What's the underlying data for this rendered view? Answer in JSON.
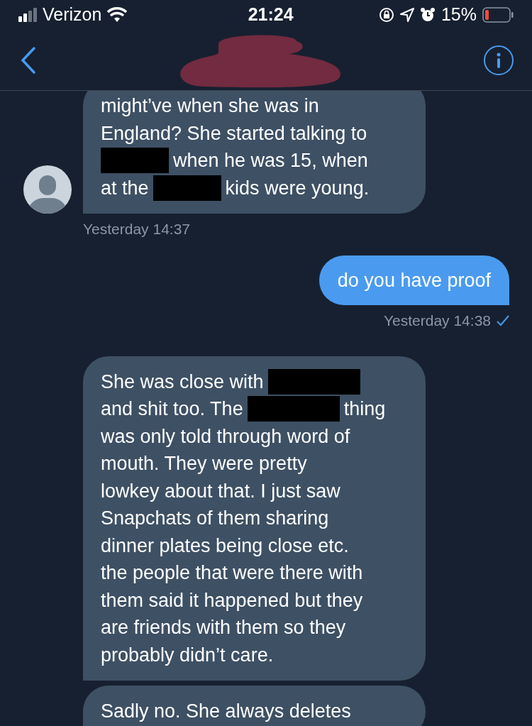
{
  "status_bar": {
    "carrier": "Verizon",
    "time": "21:24",
    "battery": "15%"
  },
  "header": {
    "title_redacted": true
  },
  "messages": [
    {
      "kind": "received",
      "avatar": true,
      "lines": [
        [
          {
            "kind": "text",
            "text": "might’ve when she was in"
          }
        ],
        [
          {
            "kind": "text",
            "text": "England? She started talking to"
          }
        ],
        [
          {
            "kind": "redacted"
          },
          {
            "kind": "text",
            "text": "when he was 15, when"
          }
        ],
        [
          {
            "kind": "text",
            "text": "at the"
          },
          {
            "kind": "redacted"
          },
          {
            "kind": "text",
            "text": "kids were young."
          }
        ]
      ],
      "time": "Yesterday 14:37"
    },
    {
      "kind": "sent",
      "lines": [
        [
          {
            "kind": "text",
            "text": "do you have proof"
          }
        ]
      ],
      "time": "Yesterday 14:38",
      "seen": true
    },
    {
      "kind": "received",
      "avatar": false,
      "lines": [
        [
          {
            "kind": "text",
            "text": "She was close with"
          },
          {
            "kind": "redacted"
          }
        ],
        [
          {
            "kind": "text",
            "text": "and shit too. The"
          },
          {
            "kind": "redacted"
          },
          {
            "kind": "text",
            "text": "thing"
          }
        ],
        [
          {
            "kind": "text",
            "text": "was only told through word of"
          }
        ],
        [
          {
            "kind": "text",
            "text": "mouth. They were pretty"
          }
        ],
        [
          {
            "kind": "text",
            "text": "lowkey about that. I just saw"
          }
        ],
        [
          {
            "kind": "text",
            "text": "Snapchats of them sharing"
          }
        ],
        [
          {
            "kind": "text",
            "text": "dinner plates being close etc."
          }
        ],
        [
          {
            "kind": "text",
            "text": "the people that were there with"
          }
        ],
        [
          {
            "kind": "text",
            "text": "them said it happened but they"
          }
        ],
        [
          {
            "kind": "text",
            "text": "are friends with them so they"
          }
        ],
        [
          {
            "kind": "text",
            "text": "probably didn’t care."
          }
        ]
      ]
    },
    {
      "kind": "received",
      "avatar": false,
      "lines": [
        [
          {
            "kind": "text",
            "text": "Sadly no. She always deletes"
          }
        ]
      ]
    }
  ]
}
